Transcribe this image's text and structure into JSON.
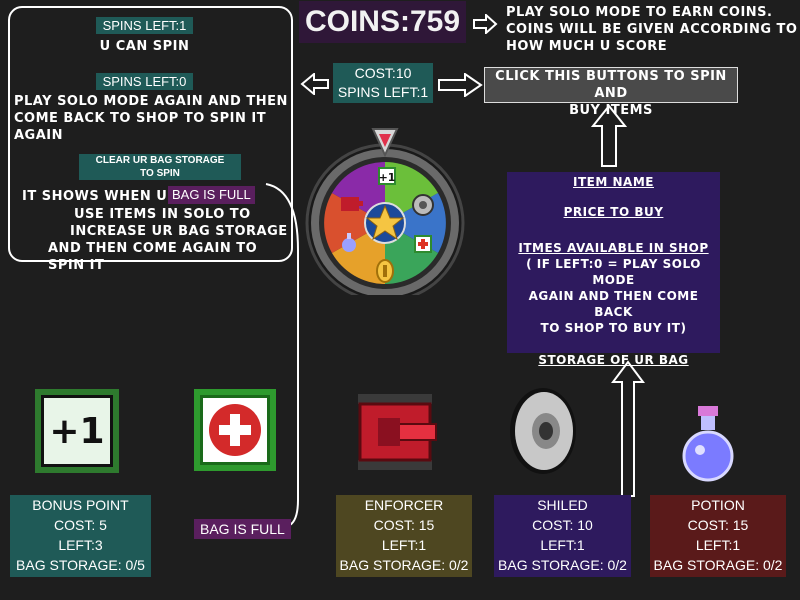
{
  "header": {
    "coins_label": "COINS:759",
    "earn_note": [
      "PLAY SOLO MODE TO EARN COINS.",
      "COINS WILL BE GIVEN ACCORDING TO",
      "HOW MUCH U SCORE"
    ]
  },
  "spin_panel": {
    "cost_label": "COST:10",
    "spins_left_label": "SPINS LEFT:1",
    "action_note": [
      "CLICK THIS BUTTONS TO SPIN AND",
      "BUY ITEMS"
    ]
  },
  "help": {
    "spins_left_1_tag": "SPINS LEFT:1",
    "spins_left_1_text": "U CAN SPIN",
    "spins_left_0_tag": "SPINS LEFT:0",
    "spins_left_0_text": [
      "PLAY SOLO MODE AGAIN AND THEN",
      "COME BACK TO SHOP TO SPIN IT AGAIN"
    ],
    "clear_tag": [
      "CLEAR UR BAG STORAGE",
      "TO SPIN"
    ],
    "bag_full_prefix": "IT SHOWS WHEN UR",
    "bag_full_tag": "BAG IS FULL",
    "bag_full_text": [
      "USE ITEMS IN SOLO TO",
      "INCREASE UR BAG STORAGE",
      "AND THEN COME AGAIN TO SPIN IT"
    ]
  },
  "legend": {
    "item_name": "ITEM NAME",
    "price": "PRICE TO BUY",
    "available": "ITMES AVAILABLE IN SHOP",
    "available_note": [
      "( IF LEFT:0 = PLAY SOLO MODE",
      "AGAIN AND THEN COME BACK",
      "TO SHOP TO BUY IT)"
    ],
    "storage": "STORAGE OF UR BAG"
  },
  "items": [
    {
      "name": "BONUS POINT",
      "cost": "COST: 5",
      "left": "LEFT:3",
      "storage": "BAG STORAGE: 0/5",
      "color": "#1f5a57",
      "icon": "plus-one-icon"
    },
    {
      "name": "ENFORCER",
      "cost": "COST: 15",
      "left": "LEFT:1",
      "storage": "BAG STORAGE: 0/2",
      "color": "#4e4721",
      "icon": "tank-icon"
    },
    {
      "name": "SHILED",
      "cost": "COST: 10",
      "left": "LEFT:1",
      "storage": "BAG STORAGE: 0/2",
      "color": "#2e1a5e",
      "icon": "shield-icon"
    },
    {
      "name": "POTION",
      "cost": "COST: 15",
      "left": "LEFT:1",
      "storage": "BAG STORAGE: 0/2",
      "color": "#5a1a1a",
      "icon": "potion-icon"
    }
  ],
  "health_item": {
    "status": "BAG IS FULL",
    "icon": "health-cross-icon"
  },
  "wheel": {
    "segments": [
      "plus-one-icon",
      "shield-icon",
      "health-cross-icon",
      "coin-icon",
      "potion-icon",
      "tank-icon"
    ],
    "center_icon": "star-icon",
    "pointer_icon": "pointer-icon"
  }
}
